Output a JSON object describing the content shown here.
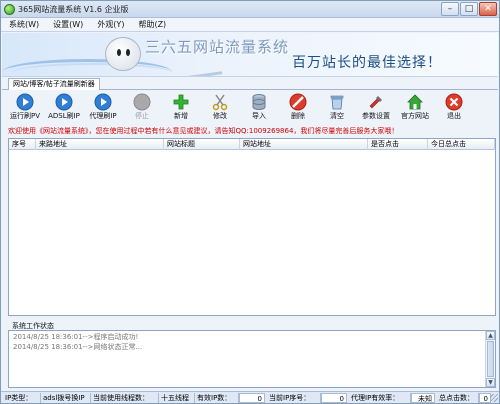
{
  "window": {
    "title": "365网站流量系统 V1.6 企业版"
  },
  "menu": [
    "系统(W)",
    "设置(W)",
    "外观(Y)",
    "帮助(Z)"
  ],
  "banner": {
    "title": "三六五网站流量系统",
    "slogan": "百万站长的最佳选择！"
  },
  "tab": {
    "label": "网站/博客/帖子流量刷新器"
  },
  "toolbar": [
    {
      "label": "运行刷PV",
      "icon": "play-icon"
    },
    {
      "label": "ADSL刷IP",
      "icon": "play-icon"
    },
    {
      "label": "代理刷IP",
      "icon": "play-icon"
    },
    {
      "label": "停止",
      "icon": "stop-icon",
      "disabled": true
    },
    {
      "label": "新增",
      "icon": "plus-icon"
    },
    {
      "label": "修改",
      "icon": "scissors-icon"
    },
    {
      "label": "导入",
      "icon": "database-icon"
    },
    {
      "label": "删除",
      "icon": "delete-icon"
    },
    {
      "label": "清空",
      "icon": "trash-icon"
    },
    {
      "label": "参数设置",
      "icon": "settings-icon"
    },
    {
      "label": "官方网站",
      "icon": "home-icon"
    },
    {
      "label": "退出",
      "icon": "exit-icon"
    }
  ],
  "notice": "欢迎使用《网站流量系统》，您在使用过程中若有什么意见或建议，请告知QQ:1009269864，我们将尽量完善后服务大家哦！",
  "grid": {
    "columns": [
      "序号",
      "来路地址",
      "网站标题",
      "网站地址",
      "是否点击",
      "今日总点击"
    ]
  },
  "log": {
    "label": "系统工作状态",
    "lines": [
      "2014/8/25 18:36:01-->程序启动成功!",
      "2014/8/25 18:36:01-->网络状态正常..."
    ]
  },
  "status": {
    "ip_type_label": "IP类型：",
    "ip_type_value": "adsl拨号换IP",
    "threads_label": "当前使用线程数：",
    "threads_value": "十五线程",
    "valid_ip_label": "有效IP数：",
    "valid_ip_value": "0",
    "ip_seq_label": "当前IP序号：",
    "ip_seq_value": "0",
    "proxy_valid_label": "代理IP有效率：",
    "proxy_valid_value": "未知",
    "total_clicks_label": "总点击数：",
    "total_clicks_value": "0"
  }
}
